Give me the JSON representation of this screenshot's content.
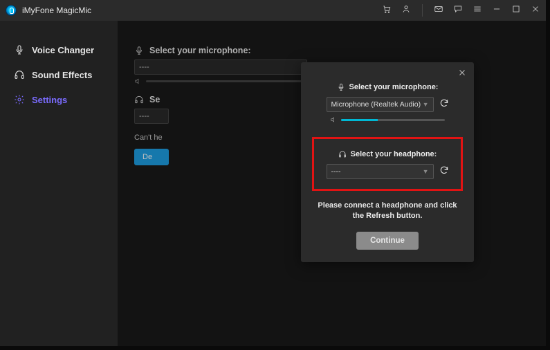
{
  "titlebar": {
    "app_name": "iMyFone MagicMic"
  },
  "sidebar": {
    "items": [
      {
        "label": "Voice Changer"
      },
      {
        "label": "Sound Effects"
      },
      {
        "label": "Settings"
      }
    ]
  },
  "bg": {
    "mic_label": "Select your microphone:",
    "mic_value": "----",
    "hp_label": "Se",
    "hp_value": "----",
    "no_hear": "Can't he",
    "detect": "De"
  },
  "modal": {
    "mic_label": "Select your microphone:",
    "mic_value": "Microphone (Realtek Audio)",
    "hp_label": "Select your headphone:",
    "hp_value": "----",
    "message_l1": "Please connect a headphone and click",
    "message_l2": "the Refresh button.",
    "continue": "Continue"
  }
}
